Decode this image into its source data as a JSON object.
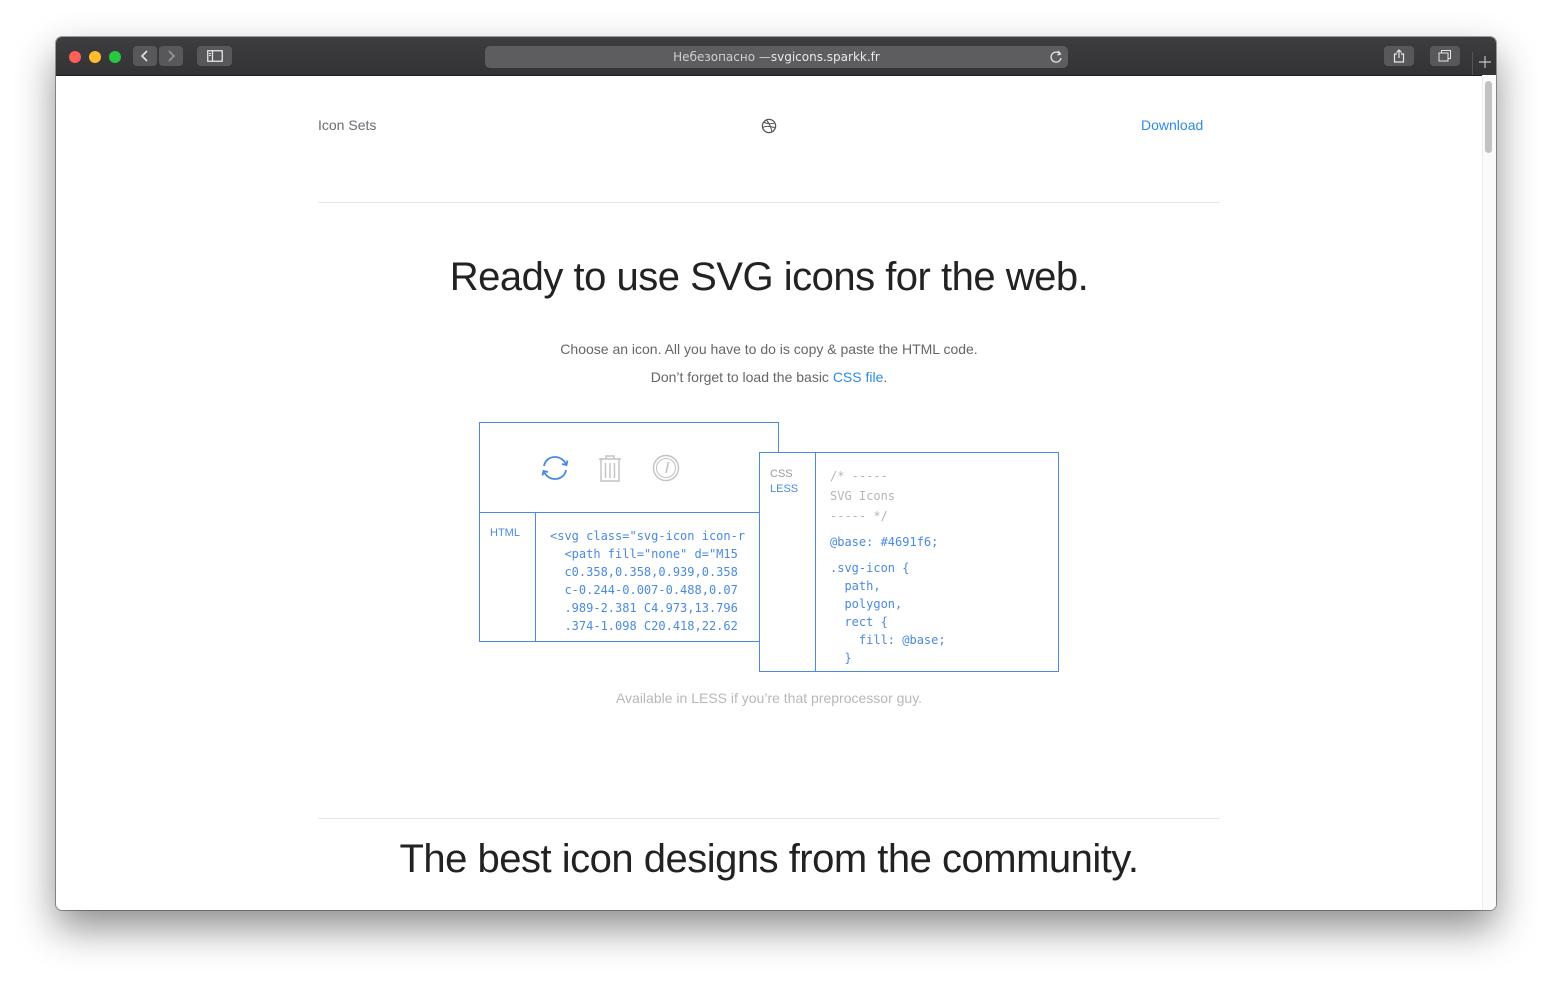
{
  "browser": {
    "url_prefix": "Небезопасно — ",
    "url_domain": "svgicons.sparkk.fr",
    "colors": {
      "close": "#fe5f57",
      "minimize": "#febc2e",
      "zoom": "#28c840"
    }
  },
  "nav": {
    "left_label": "Icon Sets",
    "center_icon": "dribbble-icon",
    "right_label": "Download"
  },
  "hero": {
    "title": "Ready to use SVG icons for the web.",
    "subtitle_line1": "Choose an icon. All you have to do is copy & paste the HTML code.",
    "subtitle_line2_prefix": "Don’t forget to load the basic ",
    "subtitle_line2_link": "CSS file",
    "subtitle_line2_suffix": "."
  },
  "html_panel": {
    "tab_label": "HTML",
    "icons": [
      "refresh-icon",
      "trash-icon",
      "gauge-icon"
    ],
    "accent": "#4a8ae0",
    "code_lines": [
      "<svg class=\"svg-icon icon-r",
      "  <path fill=\"none\" d=\"M15",
      "  c0.358,0.358,0.939,0.358",
      "  c-0.244-0.007-0.488,0.07",
      "  .989-2.381 C4.973,13.796",
      "  .374-1.098 C20.418,22.62"
    ]
  },
  "css_panel": {
    "tab_css": "CSS",
    "tab_less": "LESS",
    "comment_lines": [
      "/* -----",
      "SVG Icons",
      "----- */"
    ],
    "code_lines": [
      "@base: #4691f6;",
      ".svg-icon {",
      "  path,",
      "  polygon,",
      "  rect {",
      "    fill: @base;",
      "  }"
    ]
  },
  "caption": "Available in LESS if you’re that preprocessor guy.",
  "community_title": "The best icon designs from the community."
}
